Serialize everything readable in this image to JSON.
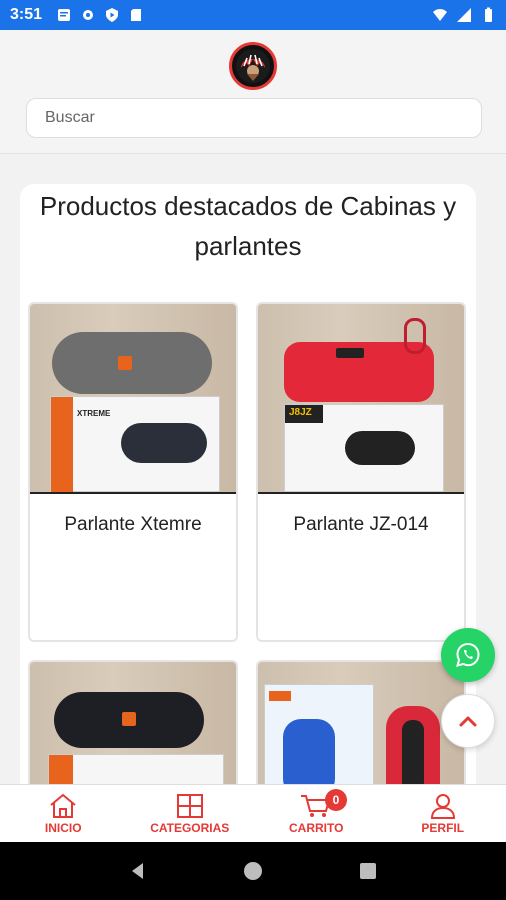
{
  "status_bar": {
    "time": "3:51"
  },
  "search": {
    "placeholder": "Buscar"
  },
  "section": {
    "title": "Productos destacados de Cabinas y parlantes"
  },
  "products": [
    {
      "name": "Parlante Xtemre",
      "box_label": "XTREME"
    },
    {
      "name": "Parlante JZ-014",
      "box_label": "J8JZ"
    },
    {
      "name": "",
      "box_label": ""
    },
    {
      "name": "",
      "box_label": ""
    }
  ],
  "bottom_nav": {
    "items": [
      {
        "label": "INICIO",
        "icon": "home-icon"
      },
      {
        "label": "CATEGORIAS",
        "icon": "grid-icon"
      },
      {
        "label": "CARRITO",
        "icon": "cart-icon"
      },
      {
        "label": "PERFIL",
        "icon": "person-icon"
      }
    ],
    "cart_count": "0"
  },
  "colors": {
    "status_bar": "#1a73e8",
    "accent": "#e53935",
    "whatsapp": "#25d366"
  }
}
